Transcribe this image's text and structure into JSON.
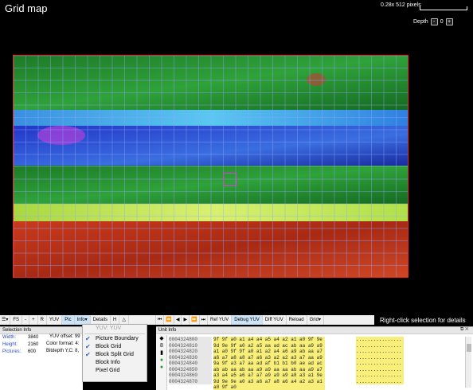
{
  "viewer": {
    "title": "Grid map",
    "zoom_label": "0.28x  512 pixels",
    "depth_label": "Depth",
    "depth_minus": "-",
    "depth_value": "0",
    "depth_plus": "+",
    "hint": "Right-click selection for details"
  },
  "toolbar": {
    "items": [
      "FS",
      "-",
      "+",
      "R",
      "YUV",
      "Pic",
      "Info",
      "Details",
      "H",
      "△"
    ],
    "nav": [
      "⏮",
      "⏪",
      "◀",
      "▶",
      "⏩",
      "⏭"
    ],
    "ref_yuv": "Ref YUV",
    "debug_yuv": "Debug YUV",
    "diff_yuv": "Diff YUV",
    "reload": "Reload",
    "grid": "Grid"
  },
  "selection_info": {
    "header": "Selection Info",
    "width_label": "Width:",
    "width": "3840",
    "height_label": "Height:",
    "height": "2160",
    "pictures_label": "Pictures:",
    "pictures": "600"
  },
  "yuv_info": {
    "offset": "YUV offset: 99",
    "format": "Color format: 4:",
    "bitdepth": "Bitdepth Y,C: 8,",
    "right_value": "152"
  },
  "unit_info": {
    "header": "Unit Info",
    "rows": [
      {
        "addr": "0004324800",
        "bytes": "9f 9f a0 a1 a4 a4 a5 a4 a2 a1 a0 9f 9e 9e 9d",
        "ascii": "................"
      },
      {
        "addr": "0004324810",
        "bytes": "9d 9e 9f a0 a2 a5 aa ad ac ab aa a9 a9 a7 a6 a3",
        "ascii": "................"
      },
      {
        "addr": "0004324820",
        "bytes": "a1 a0 9f 9f a0 a1 a2 a4 a6 a9 ab aa a7 a5 a4 a4",
        "ascii": "................"
      },
      {
        "addr": "0004324830",
        "bytes": "a6 a7 a8 a8 a7 a6 a3 a2 a2 a3 a7 aa a9 a5 9d 9d",
        "ascii": "................"
      },
      {
        "addr": "0004324840",
        "bytes": "9a 9f a3 a7 aa ad af b1 b1 b0 ae ad ac aa aa aa",
        "ascii": "................"
      },
      {
        "addr": "0004324850",
        "bytes": "ab ab aa ab aa a9 a9 aa aa ab aa a9 a7 a5 a5 a5",
        "ascii": "................"
      },
      {
        "addr": "0004324860",
        "bytes": "a3 a4 a5 a6 a7 a7 a9 a9 a9 a8 a3 a1 9e 9c 9b 9c",
        "ascii": "................"
      },
      {
        "addr": "0004324870",
        "bytes": "9d 9e 9e a0 a3 a6 a7 a8 a6 a4 a2 a3 a1 a0 9f a0",
        "ascii": "................"
      }
    ]
  },
  "grid_menu": {
    "items": [
      {
        "label": "YUV: YUV",
        "checked": false,
        "disabled": true
      },
      {
        "label": "Picture Boundary",
        "checked": true,
        "disabled": false
      },
      {
        "label": "Block Grid",
        "checked": true,
        "disabled": false
      },
      {
        "label": "Block Split Grid",
        "checked": true,
        "disabled": false
      },
      {
        "label": "Block Info",
        "checked": false,
        "disabled": false
      },
      {
        "label": "Pixel Grid",
        "checked": false,
        "disabled": false
      }
    ]
  },
  "colors": {
    "picture_boundary": "#e22222",
    "block_grid": "#8fa6ff",
    "selection": "#e040e0",
    "band_colors": [
      "#1f8a2e",
      "#2a9e3a",
      "#3bb0e8",
      "#2040d8",
      "#2e9a34",
      "#b8e24a",
      "#d03a20"
    ]
  }
}
